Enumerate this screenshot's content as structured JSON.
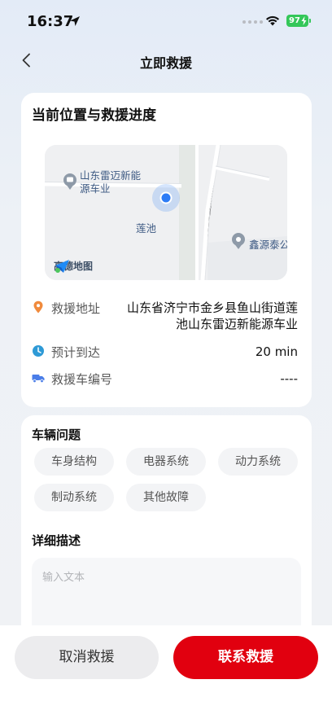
{
  "status_bar": {
    "time": "16:37",
    "battery": "97"
  },
  "nav": {
    "title": "立即救援"
  },
  "location_card": {
    "title": "当前位置与救援进度",
    "map": {
      "label_business": "山东雷迈新能源车业",
      "label_place": "莲池",
      "label_poi": "鑫源泰公",
      "logo": "高德地图"
    },
    "address": {
      "label": "救援地址",
      "value": "山东省济宁市金乡县鱼山街道莲池山东雷迈新能源车业"
    },
    "eta": {
      "label": "预计到达",
      "value": "20 min"
    },
    "vehicle": {
      "label": "救援车编号",
      "value": "----"
    }
  },
  "problem_card": {
    "title": "车辆问题",
    "chips": [
      "车身结构",
      "电器系统",
      "动力系统",
      "制动系统",
      "其他故障"
    ],
    "description_title": "详细描述",
    "description_placeholder": "输入文本"
  },
  "actions": {
    "cancel": "取消救援",
    "contact": "联系救援"
  },
  "colors": {
    "accent": "#e1000f",
    "map_dot": "#2d7cf6"
  }
}
